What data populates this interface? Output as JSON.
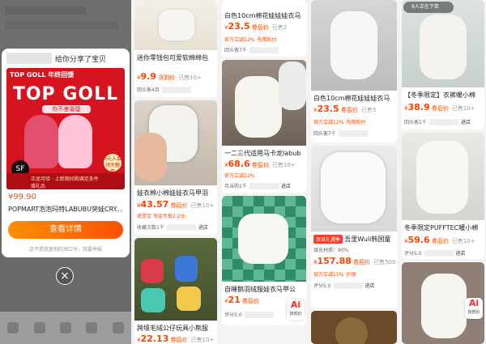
{
  "share": {
    "sender_suffix": "给你分享了宝贝",
    "brand": "TOP GOLL 年终回馈",
    "logo": "TOP GOLL",
    "subtitle": "你不差毫厘",
    "bar_text": "正品可验 · 上新期间购满足条件赠礼品",
    "badge": "0元入会 领大额券",
    "sf": "SF",
    "price": "¥99.90",
    "title": "POPMART泡泡玛特LABUBU突娃CRY...",
    "button": "查看详情",
    "note": "这不是我复制的淘口令，我要举报",
    "close": "×"
  },
  "col2": {
    "top": {
      "title": "迷你零钱包可爱软绵绵包",
      "price": "9.9",
      "price_prefix": "¥",
      "tag": "货到价",
      "sales": "已售10+",
      "meta": "回头客4百",
      "shop": ""
    },
    "mid": {
      "title": "娃衣棉小棉娃娃衣马甲羽",
      "price": "43.57",
      "price_prefix": "¥",
      "tag": "券后价",
      "sales": "已售10+",
      "sub": "退货宝  淘金币抵2.2元",
      "meta": "收藏次数1千",
      "shop": "进店"
    },
    "bottom": {
      "title": "跨境毛绒公仔玩具小熊服",
      "price": "22.13",
      "price_prefix": "¥",
      "tag": "券后价",
      "sales": "已售10+"
    }
  },
  "col3": {
    "top": {
      "title": "白色10cm棉花娃娃娃衣马",
      "price": "23.5",
      "price_prefix": "¥",
      "tag": "券后价",
      "sales": "已售2",
      "sub": "官方立减12%",
      "sub2": "先用后付",
      "meta": "回头客7千"
    },
    "mid": {
      "title": "一二三代适用马卡龙labub",
      "price": "68.6",
      "price_prefix": "¥",
      "tag": "券后价",
      "sales": "已售10+",
      "sub": "官方立减12%",
      "meta": "月当购1千",
      "shop": "进店"
    },
    "bottom": {
      "title": "自睡鹅羽绒服娃衣马甲公",
      "price": "21",
      "price_prefix": "¥",
      "tag": "券后价",
      "sales": "",
      "meta": "评分5.0",
      "ai_label": "Ai",
      "ai_sub": "找低价"
    }
  },
  "col4": {
    "top": {
      "title": "白色10cm棉花娃娃娃衣马",
      "price": "23.5",
      "price_prefix": "¥",
      "tag": "券后价",
      "sales": "已售5",
      "sub": "官方立减12%",
      "sub2": "先用后付",
      "meta": "回头客7千"
    },
    "bottom": {
      "badge": "双旦礼遇季",
      "title": "吾里Wuli韩国童",
      "sub_meta": "填充材质：90%",
      "price": "157.88",
      "price_prefix": "¥",
      "tag": "券后价",
      "sales": "已售500+",
      "sub": "官方立减15%",
      "sub2": "价保",
      "meta": "评分5.0",
      "shop": "进店"
    }
  },
  "col5": {
    "top": {
      "banner": "8人正在下单",
      "title": "【冬季限定】衣裤暖小棉",
      "price": "38.9",
      "price_prefix": "¥",
      "tag": "券后价",
      "sales": "已售10+",
      "meta": "回头客1千",
      "shop": "进店"
    },
    "mid": {
      "title": "冬季限定PUFFTEC暖小棉",
      "price": "59.6",
      "price_prefix": "¥",
      "tag": "券后价",
      "sales": "已售10+",
      "meta": "评分5.0",
      "shop": "进店"
    },
    "bottom": {
      "ai_label": "Ai",
      "ai_sub": "找低价"
    }
  }
}
